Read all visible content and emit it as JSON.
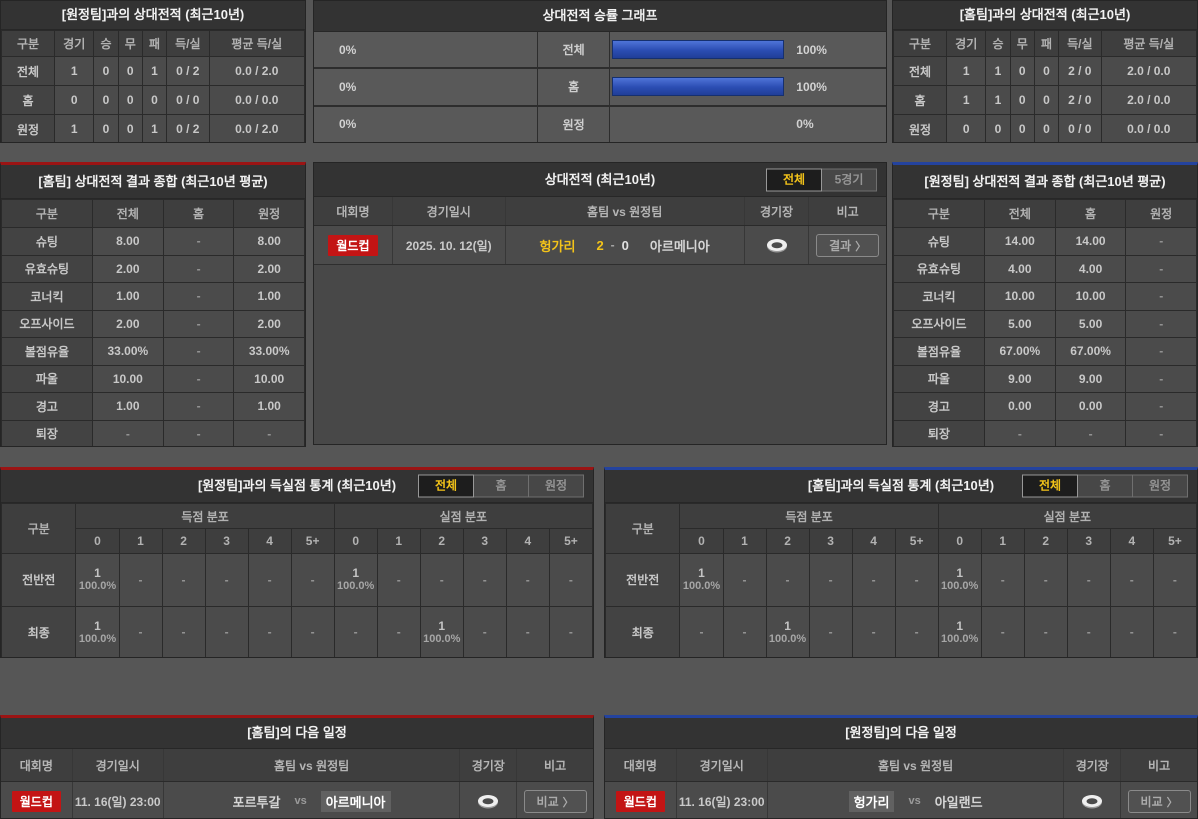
{
  "h2h_away": {
    "title": "[원정팀]과의 상대전적 (최근10년)",
    "headers": [
      "구분",
      "경기",
      "승",
      "무",
      "패",
      "득/실",
      "평균 득/실"
    ],
    "rows": [
      [
        "전체",
        "1",
        "0",
        "0",
        "1",
        "0 / 2",
        "0.0 / 2.0"
      ],
      [
        "홈",
        "0",
        "0",
        "0",
        "0",
        "0 / 0",
        "0.0 / 0.0"
      ],
      [
        "원정",
        "1",
        "0",
        "0",
        "1",
        "0 / 2",
        "0.0 / 2.0"
      ]
    ]
  },
  "win_rate_graph": {
    "title": "상대전적 승률 그래프",
    "rows": [
      {
        "label": "전체",
        "left_label": "0%",
        "left_pct": 0,
        "right_label": "100%",
        "right_pct": 100
      },
      {
        "label": "홈",
        "left_label": "0%",
        "left_pct": 0,
        "right_label": "100%",
        "right_pct": 100
      },
      {
        "label": "원정",
        "left_label": "0%",
        "left_pct": 0,
        "right_label": "0%",
        "right_pct": 0
      }
    ],
    "bar_color": "#2b4db2"
  },
  "h2h_home": {
    "title": "[홈팀]과의 상대전적 (최근10년)",
    "headers": [
      "구분",
      "경기",
      "승",
      "무",
      "패",
      "득/실",
      "평균 득/실"
    ],
    "rows": [
      [
        "전체",
        "1",
        "1",
        "0",
        "0",
        "2 / 0",
        "2.0 / 0.0"
      ],
      [
        "홈",
        "1",
        "1",
        "0",
        "0",
        "2 / 0",
        "2.0 / 0.0"
      ],
      [
        "원정",
        "0",
        "0",
        "0",
        "0",
        "0 / 0",
        "0.0 / 0.0"
      ]
    ]
  },
  "home_summary": {
    "title": "[홈팀] 상대전적 결과 종합 (최근10년 평균)",
    "headers": [
      "구분",
      "전체",
      "홈",
      "원정"
    ],
    "rows": [
      [
        "슈팅",
        "8.00",
        "-",
        "8.00"
      ],
      [
        "유효슈팅",
        "2.00",
        "-",
        "2.00"
      ],
      [
        "코너킥",
        "1.00",
        "-",
        "1.00"
      ],
      [
        "오프사이드",
        "2.00",
        "-",
        "2.00"
      ],
      [
        "볼점유율",
        "33.00%",
        "-",
        "33.00%"
      ],
      [
        "파울",
        "10.00",
        "-",
        "10.00"
      ],
      [
        "경고",
        "1.00",
        "-",
        "1.00"
      ],
      [
        "퇴장",
        "-",
        "-",
        "-"
      ]
    ]
  },
  "away_summary": {
    "title": "[원정팀] 상대전적 결과 종합 (최근10년 평균)",
    "headers": [
      "구분",
      "전체",
      "홈",
      "원정"
    ],
    "rows": [
      [
        "슈팅",
        "14.00",
        "14.00",
        "-"
      ],
      [
        "유효슈팅",
        "4.00",
        "4.00",
        "-"
      ],
      [
        "코너킥",
        "10.00",
        "10.00",
        "-"
      ],
      [
        "오프사이드",
        "5.00",
        "5.00",
        "-"
      ],
      [
        "볼점유율",
        "67.00%",
        "67.00%",
        "-"
      ],
      [
        "파울",
        "9.00",
        "9.00",
        "-"
      ],
      [
        "경고",
        "0.00",
        "0.00",
        "-"
      ],
      [
        "퇴장",
        "-",
        "-",
        "-"
      ]
    ]
  },
  "h2h_matches": {
    "title": "상대전적 (최근10년)",
    "tabs": [
      {
        "label": "전체",
        "active": true
      },
      {
        "label": "5경기",
        "active": false
      }
    ],
    "headers": [
      "대회명",
      "경기일시",
      "홈팀  vs  원정팀",
      "경기장",
      "비고"
    ],
    "match": {
      "competition": "월드컵",
      "date": "2025. 10. 12(일)",
      "home": "헝가리",
      "score_home": "2",
      "score_sep": "-",
      "score_away": "0",
      "away": "아르메니아",
      "venue_icon": "stadium-icon",
      "action": "결과",
      "action_arrow": "〉"
    }
  },
  "goal_stats_away": {
    "title": "[원정팀]과의 득실점 통계 (최근10년)",
    "tabs": [
      {
        "label": "전체",
        "active": true
      },
      {
        "label": "홈",
        "active": false
      },
      {
        "label": "원정",
        "active": false
      }
    ],
    "col_header": "구분",
    "groups": [
      "득점 분포",
      "실점 분포"
    ],
    "score_headers": [
      "0",
      "1",
      "2",
      "3",
      "4",
      "5+"
    ],
    "rows": [
      {
        "label": "전반전",
        "scored": [
          "1|100.0%",
          "-",
          "-",
          "-",
          "-",
          "-"
        ],
        "conceded": [
          "1|100.0%",
          "-",
          "-",
          "-",
          "-",
          "-"
        ]
      },
      {
        "label": "최종",
        "scored": [
          "1|100.0%",
          "-",
          "-",
          "-",
          "-",
          "-"
        ],
        "conceded": [
          "-",
          "-",
          "1|100.0%",
          "-",
          "-",
          "-"
        ]
      }
    ]
  },
  "goal_stats_home": {
    "title": "[홈팀]과의 득실점 통계 (최근10년)",
    "tabs": [
      {
        "label": "전체",
        "active": true
      },
      {
        "label": "홈",
        "active": false
      },
      {
        "label": "원정",
        "active": false
      }
    ],
    "col_header": "구분",
    "groups": [
      "득점 분포",
      "실점 분포"
    ],
    "score_headers": [
      "0",
      "1",
      "2",
      "3",
      "4",
      "5+"
    ],
    "rows": [
      {
        "label": "전반전",
        "scored": [
          "1|100.0%",
          "-",
          "-",
          "-",
          "-",
          "-"
        ],
        "conceded": [
          "1|100.0%",
          "-",
          "-",
          "-",
          "-",
          "-"
        ]
      },
      {
        "label": "최종",
        "scored": [
          "-",
          "-",
          "1|100.0%",
          "-",
          "-",
          "-"
        ],
        "conceded": [
          "1|100.0%",
          "-",
          "-",
          "-",
          "-",
          "-"
        ]
      }
    ]
  },
  "home_next": {
    "title": "[홈팀]의 다음 일정",
    "headers": [
      "대회명",
      "경기일시",
      "홈팀  vs  원정팀",
      "경기장",
      "비고"
    ],
    "match": {
      "competition": "월드컵",
      "date": "11. 16(일) 23:00",
      "home": "포르투갈",
      "home_highlight": false,
      "vs": "vs",
      "away": "아르메니아",
      "away_highlight": true,
      "venue_icon": "stadium-icon",
      "action": "비교",
      "action_arrow": "〉"
    }
  },
  "away_next": {
    "title": "[원정팀]의 다음 일정",
    "headers": [
      "대회명",
      "경기일시",
      "홈팀  vs  원정팀",
      "경기장",
      "비고"
    ],
    "match": {
      "competition": "월드컵",
      "date": "11. 16(일) 23:00",
      "home": "헝가리",
      "home_highlight": true,
      "vs": "vs",
      "away": "아일랜드",
      "away_highlight": false,
      "venue_icon": "stadium-icon",
      "action": "비교",
      "action_arrow": "〉"
    }
  },
  "colors": {
    "accent_yellow": "#f3c319",
    "badge_red": "#c31414",
    "bar_blue": "#2b4db2",
    "panel_red_border": "#9b1414",
    "panel_blue_border": "#24439e"
  }
}
